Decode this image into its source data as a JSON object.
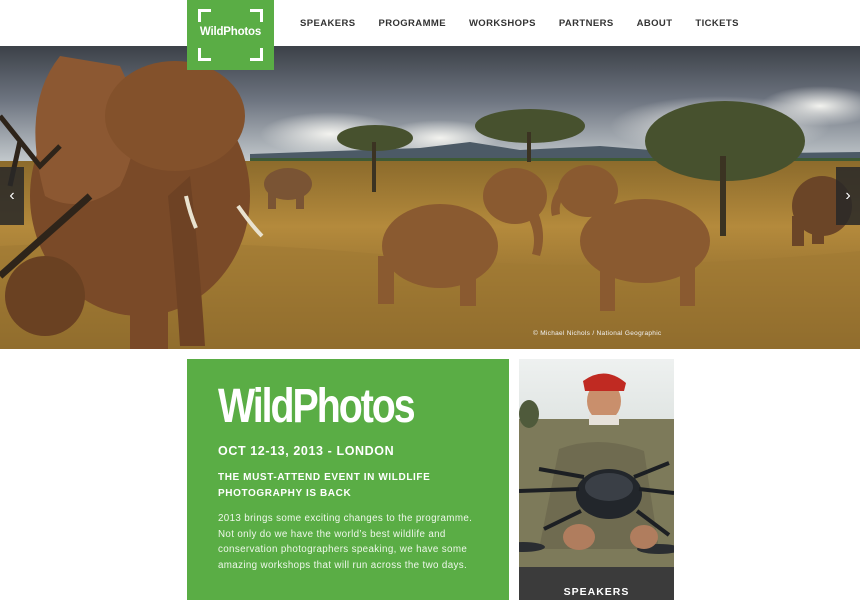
{
  "header": {
    "logo_text": "WildPhotos",
    "nav": [
      "SPEAKERS",
      "PROGRAMME",
      "WORKSHOPS",
      "PARTNERS",
      "ABOUT",
      "TICKETS"
    ]
  },
  "hero": {
    "credit": "© Michael Nichols / National Geographic",
    "prev_arrow": "‹",
    "next_arrow": "›"
  },
  "intro": {
    "title": "WildPhotos",
    "date": "OCT 12-13, 2013 - LONDON",
    "tagline": "THE MUST-ATTEND EVENT IN WILDLIFE PHOTOGRAPHY IS BACK",
    "body": "2013 brings some exciting changes to the programme. Not only do we have the world’s best wildlife and conservation photographers speaking, we have some amazing workshops that will run across the two days."
  },
  "speakers_tile": {
    "label": "SPEAKERS"
  },
  "colors": {
    "brand_green": "#5aad45",
    "nav_text": "#333333",
    "dark_bar": "#3b3b3b"
  }
}
